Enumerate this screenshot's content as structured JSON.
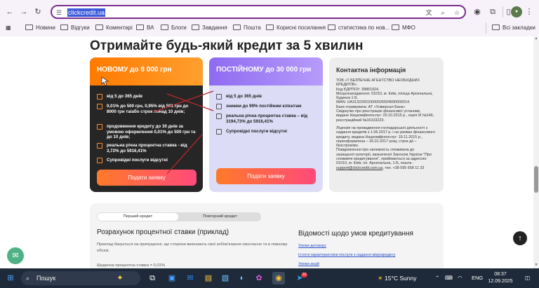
{
  "browser": {
    "url": "clickcredit.ua",
    "bookmarks": [
      "Новини",
      "Відгуки",
      "Коментарі",
      "ВА",
      "Блоги",
      "Завдання",
      "Пошта",
      "Корисні посилання",
      "статистика по нов...",
      "МФО"
    ],
    "all_bookmarks": "Всі закладки"
  },
  "page": {
    "headline": "Отримайте будь-який кредит за 5 хвилин",
    "card_new": {
      "title": "НОВОМУ до 8 000 грн",
      "items": [
        "від 5 до 365 днів",
        "0,01% до 500 грн, 0,95% від 501 грн до 8000 грн та/або строк понад 10 днів;",
        "продовження кредиту до 30 днів за умовою оформлення 0,01% до 500 грн та до 10 днів;",
        "реальна річна процентна ставка - від 3,72% до 5916,41%",
        "Супровідні послуги відсутні"
      ],
      "button": "Подати заявку"
    },
    "card_regular": {
      "title": "ПОСТІЙНОМУ до 30 000 грн",
      "items": [
        "від 5 до 365 днів",
        "знижки до 99% постійним клієнтам",
        "реальна річна процентна ставка – від 3194,73% до 5916,41%",
        "Супровідні послуги відсутні"
      ],
      "button": "Подати заявку"
    },
    "contact": {
      "title": "Контактна інформація",
      "lines": [
        "ТОВ «Т БЕЗПЕЧНЕ АГЕНТСТВО НЕОБХІДНИХ",
        "КРЕДИТІВ».",
        "Код ЄДРПОУ: 39861924.",
        "Місцезнаходження: 01010, м. Київ, площа Арсенальна,",
        "будинок 1-Б.",
        "IBAN: UA313220010000026504690000014.",
        "Банк отримувача: АТ «Універсал Банк».",
        "Свідоцтво про реєстрацію фінансової установи,",
        "видане Нацкомфінпослуг: 20.10.2015 р., серія ІК №146,",
        "реєстраційний №16103223.",
        "",
        "Ліцензія на провадження господарської діяльності з",
        "надання кредитів з 1.06.2017 р. і на умовах фінансового",
        "кредиту, видана Нацкомфінпослуг: 19.11.2015 р.,",
        "переоформлена – 26.01.2017 року, строк дії –",
        "безстроково.",
        "Повідомлення про належність споживача до",
        "захищеної категорії, визначеної Законом України \"Про",
        "споживче кредитування\", приймаються за адресою:",
        "01010, м. Київ, пл. Арсенальна, 1-Б, пошта -"
      ],
      "email": "support@clickcredit.com.ua",
      "phone": ", тел. +38 095 658 11 33"
    },
    "tabs": [
      "Перший кредит",
      "Повторний кредит"
    ],
    "calc_title": "Розрахунок процентної ставки (приклад)",
    "calc_text": "Приклад базується на припущенні, що сторони виконають свої зобов'язання своєчасно та в повному обсязі.",
    "calc_rate": "Щоденна процентна ставка = 0,01%",
    "terms_title": "Відомості щодо умов кредитування",
    "terms_links": [
      "Умови договору",
      "Істотні характеристики послуги з надання мікрокредиту",
      "Умови акцій"
    ]
  },
  "taskbar": {
    "search": "Пошук",
    "weather": "15°C  Sunny",
    "lang": "ENG",
    "time": "08:37",
    "date": "12.09.2025",
    "badge": "10"
  }
}
